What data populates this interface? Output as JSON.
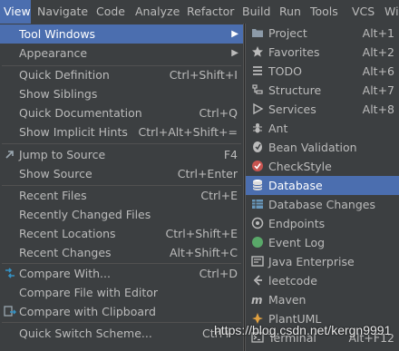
{
  "menubar": [
    "View",
    "Navigate",
    "Code",
    "Analyze",
    "Refactor",
    "Build",
    "Run",
    "Tools",
    "VCS",
    "Wi"
  ],
  "menu": {
    "tool_windows": "Tool Windows",
    "appearance": "Appearance",
    "quick_definition": {
      "label": "Quick Definition",
      "shortcut": "Ctrl+Shift+I"
    },
    "show_siblings": {
      "label": "Show Siblings"
    },
    "quick_documentation": {
      "label": "Quick Documentation",
      "shortcut": "Ctrl+Q"
    },
    "show_implicit_hints": {
      "label": "Show Implicit Hints",
      "shortcut": "Ctrl+Alt+Shift+="
    },
    "jump_to_source": {
      "label": "Jump to Source",
      "shortcut": "F4"
    },
    "show_source": {
      "label": "Show Source",
      "shortcut": "Ctrl+Enter"
    },
    "recent_files": {
      "label": "Recent Files",
      "shortcut": "Ctrl+E"
    },
    "recently_changed_files": {
      "label": "Recently Changed Files"
    },
    "recent_locations": {
      "label": "Recent Locations",
      "shortcut": "Ctrl+Shift+E"
    },
    "recent_changes": {
      "label": "Recent Changes",
      "shortcut": "Alt+Shift+C"
    },
    "compare_with": {
      "label": "Compare With...",
      "shortcut": "Ctrl+D"
    },
    "compare_file_with_editor": {
      "label": "Compare File with Editor"
    },
    "compare_with_clipboard": {
      "label": "Compare with Clipboard"
    },
    "quick_switch_scheme": {
      "label": "Quick Switch Scheme...",
      "shortcut": "Ctrl+`"
    }
  },
  "submenu": [
    {
      "label": "Project",
      "shortcut": "Alt+1",
      "icon": "folder-icon",
      "color": "#8c9aa8"
    },
    {
      "label": "Favorites",
      "shortcut": "Alt+2",
      "icon": "star-icon",
      "color": "#bbbbbb"
    },
    {
      "label": "TODO",
      "shortcut": "Alt+6",
      "icon": "list-icon",
      "color": "#bbbbbb"
    },
    {
      "label": "Structure",
      "shortcut": "Alt+7",
      "icon": "structure-icon",
      "color": "#bbbbbb"
    },
    {
      "label": "Services",
      "shortcut": "Alt+8",
      "icon": "services-icon",
      "color": "#bbbbbb"
    },
    {
      "label": "Ant",
      "shortcut": "",
      "icon": "ant-icon",
      "color": "#bbbbbb"
    },
    {
      "label": "Bean Validation",
      "shortcut": "",
      "icon": "bean-validation-icon",
      "color": "#bbbbbb"
    },
    {
      "label": "CheckStyle",
      "shortcut": "",
      "icon": "checkstyle-icon",
      "color": "#c75450"
    },
    {
      "label": "Database",
      "shortcut": "",
      "icon": "database-icon",
      "color": "#bbbbbb"
    },
    {
      "label": "Database Changes",
      "shortcut": "",
      "icon": "database-changes-icon",
      "color": "#6897bb"
    },
    {
      "label": "Endpoints",
      "shortcut": "",
      "icon": "endpoints-icon",
      "color": "#bbbbbb"
    },
    {
      "label": "Event Log",
      "shortcut": "",
      "icon": "event-log-icon",
      "color": "#59a869"
    },
    {
      "label": "Java Enterprise",
      "shortcut": "",
      "icon": "java-enterprise-icon",
      "color": "#bbbbbb"
    },
    {
      "label": "leetcode",
      "shortcut": "",
      "icon": "leetcode-icon",
      "color": "#bbbbbb"
    },
    {
      "label": "Maven",
      "shortcut": "",
      "icon": "maven-icon",
      "color": "#bbbbbb"
    },
    {
      "label": "PlantUML",
      "shortcut": "",
      "icon": "plantuml-icon",
      "color": "#e0a040"
    },
    {
      "label": "Terminal",
      "shortcut": "Alt+F12",
      "icon": "terminal-icon",
      "color": "#bbbbbb"
    }
  ],
  "watermark": "https://blog.csdn.net/kergn9991",
  "colors": {
    "highlight": "#4b6eaf",
    "menu_bg": "#3c3f41",
    "text": "#bbbbbb"
  }
}
